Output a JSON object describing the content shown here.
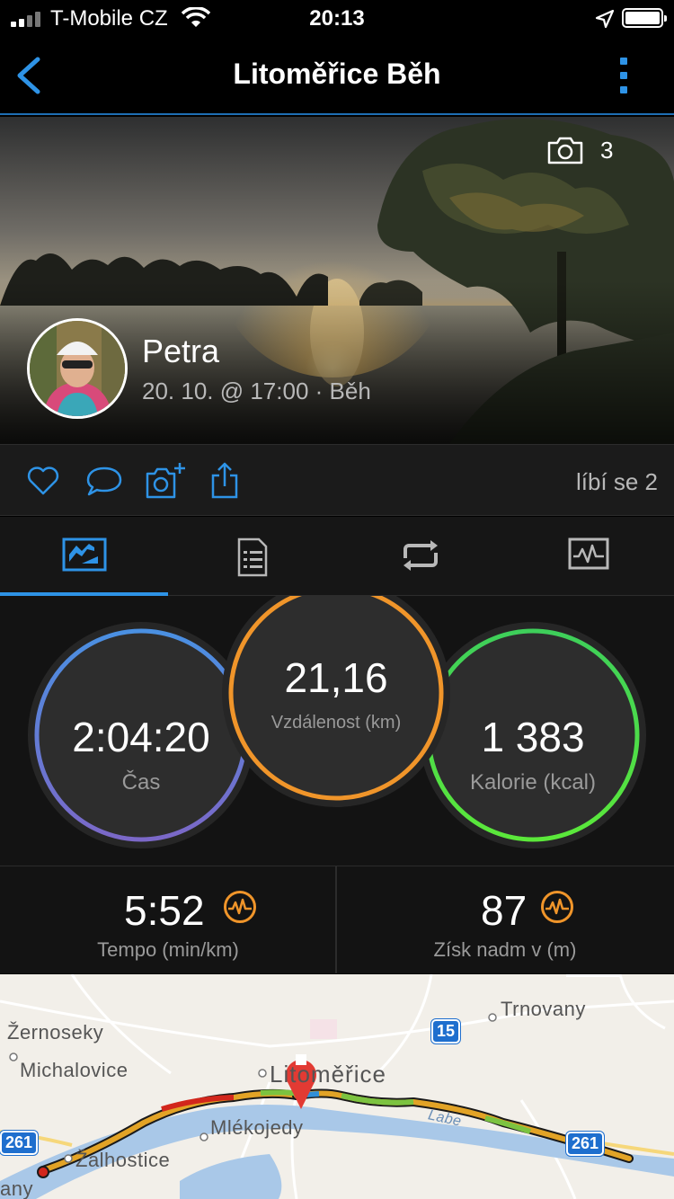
{
  "status_bar": {
    "carrier": "T-Mobile CZ",
    "time": "20:13"
  },
  "nav": {
    "title": "Litoměřice Běh"
  },
  "hero": {
    "photo_count": "3",
    "user_name": "Petra",
    "meta": "20. 10. @ 17:00 · Běh"
  },
  "actions": {
    "likes_label": "líbí se 2"
  },
  "tabs": [
    {
      "icon": "stats-chart-icon",
      "active": true
    },
    {
      "icon": "details-list-icon",
      "active": false
    },
    {
      "icon": "laps-loop-icon",
      "active": false
    },
    {
      "icon": "graph-icon",
      "active": false
    }
  ],
  "rings": {
    "time": {
      "value": "2:04:20",
      "label": "Čas",
      "colors": [
        "#4a90e2",
        "#7b68c8"
      ]
    },
    "distance": {
      "value": "21,16",
      "label": "Vzdálenost (km)",
      "color": "#f0952a"
    },
    "calories": {
      "value": "1 383",
      "label": "Kalorie (kcal)",
      "colors": [
        "#3ecf5a",
        "#5be83a"
      ]
    }
  },
  "metrics": {
    "pace": {
      "value": "5:52",
      "label": "Tempo (min/km)"
    },
    "elevation": {
      "value": "87",
      "label": "Získ nadm v (m)"
    }
  },
  "map": {
    "places": {
      "zernoseky": "Žernoseky",
      "michalovice": "Michalovice",
      "mlekojedy": "Mlékojedy",
      "zalhostice": "Žalhostice",
      "trnovany": "Trnovany",
      "litomerice": "Litoměřice",
      "labe": "Labe",
      "any": "any"
    },
    "shields": {
      "road_15": "15",
      "road_261_left": "261",
      "road_261_right": "261"
    }
  },
  "colors": {
    "accent": "#2e93e6",
    "pace_badge": "#f0952a"
  }
}
